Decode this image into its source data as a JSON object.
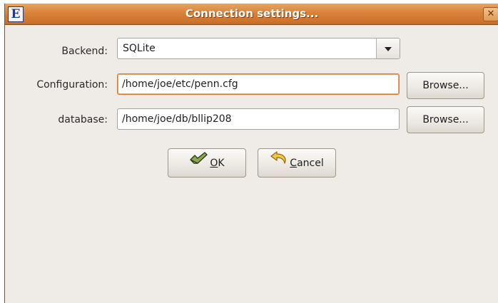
{
  "window": {
    "title": "Connection settings...",
    "icon_letter": "E",
    "close_glyph": "✕"
  },
  "form": {
    "backend": {
      "label": "Backend:",
      "value": "SQLite"
    },
    "configuration": {
      "label": "Configuration:",
      "value": "/home/joe/etc/penn.cfg",
      "browse_label": "Browse..."
    },
    "database": {
      "label": "database:",
      "value": "/home/joe/db/bllip208",
      "browse_label": "Browse..."
    }
  },
  "buttons": {
    "ok": {
      "mnemonic": "O",
      "rest": "K"
    },
    "cancel": {
      "mnemonic": "C",
      "rest": "ancel"
    }
  },
  "icons": {
    "ok": "checkmark-hand-icon",
    "cancel": "undo-arrow-icon",
    "dropdown": "chevron-down-icon"
  }
}
